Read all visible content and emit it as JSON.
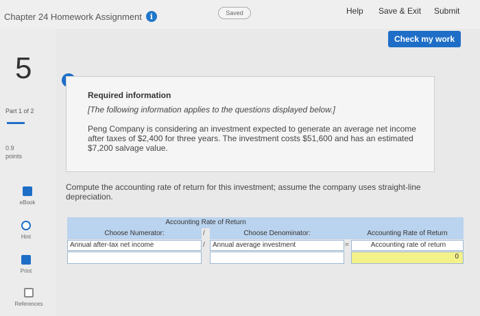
{
  "header": {
    "title": "Chapter 24 Homework Assignment",
    "status": "Saved",
    "help": "Help",
    "save_exit": "Save & Exit",
    "submit": "Submit",
    "check_work": "Check my work"
  },
  "sidebar": {
    "question_number": "5",
    "part": "Part 1 of 2",
    "points_value": "0.9",
    "points_label": "points",
    "tools": [
      {
        "label": "eBook",
        "icon": "ebook-icon"
      },
      {
        "label": "Hint",
        "icon": "hint-icon"
      },
      {
        "label": "Print",
        "icon": "print-icon"
      },
      {
        "label": "References",
        "icon": "references-icon"
      }
    ]
  },
  "required": {
    "title": "Required information",
    "note": "[The following information applies to the questions displayed below.]",
    "body": "Peng Company is considering an investment expected to generate an average net income after taxes of $2,400 for three years. The investment costs $51,600 and has an estimated $7,200 salvage value."
  },
  "question": "Compute the accounting rate of return for this investment; assume the company uses straight-line depreciation.",
  "table": {
    "header_main": "Accounting Rate of Return",
    "numerator_label": "Choose Numerator:",
    "denominator_label": "Choose Denominator:",
    "result_header": "Accounting Rate of Return",
    "result_label": "Accounting rate of return",
    "numerator_value": "Annual after-tax net income",
    "denominator_value": "Annual average investment",
    "divide_symbol": "/",
    "equals_symbol": "=",
    "result_value": "0"
  },
  "colors": {
    "accent": "#1e6ec7",
    "header_fill": "#bad3ee",
    "result_fill": "#f3f18a"
  }
}
